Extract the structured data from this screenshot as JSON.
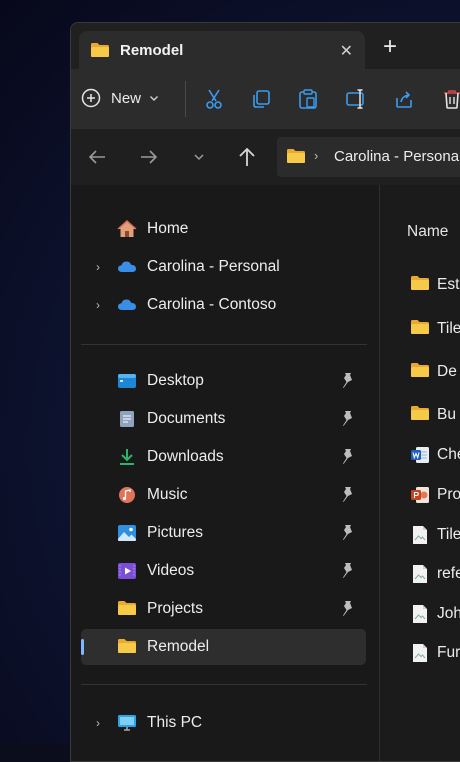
{
  "tab": {
    "title": "Remodel",
    "close_glyph": "✕",
    "new_tab_glyph": "+"
  },
  "toolbar": {
    "new_label": "New",
    "buttons": [
      "cut-icon",
      "copy-icon",
      "paste-icon",
      "rename-icon",
      "share-icon",
      "delete-icon"
    ]
  },
  "address": {
    "chevron": "›",
    "path": "Carolina - Personal"
  },
  "sidebar": {
    "items": [
      {
        "label": "Home",
        "icon": "home-icon"
      },
      {
        "label": "Carolina - Personal",
        "icon": "cloud-icon",
        "expandable": true
      },
      {
        "label": "Carolina - Contoso",
        "icon": "cloud-icon",
        "expandable": true
      },
      {
        "label": "Desktop",
        "icon": "desktop-icon",
        "pinned": true
      },
      {
        "label": "Documents",
        "icon": "documents-icon",
        "pinned": true
      },
      {
        "label": "Downloads",
        "icon": "downloads-icon",
        "pinned": true
      },
      {
        "label": "Music",
        "icon": "music-icon",
        "pinned": true
      },
      {
        "label": "Pictures",
        "icon": "pictures-icon",
        "pinned": true
      },
      {
        "label": "Videos",
        "icon": "videos-icon",
        "pinned": true
      },
      {
        "label": "Projects",
        "icon": "folder-icon",
        "pinned": true
      },
      {
        "label": "Remodel",
        "icon": "folder-icon",
        "selected": true
      },
      {
        "label": "This PC",
        "icon": "pc-icon",
        "expandable": true
      }
    ],
    "chevron_glyph": "›"
  },
  "filelist": {
    "column_name": "Name",
    "files": [
      {
        "name": "Est",
        "icon": "folder-icon"
      },
      {
        "name": "Tile",
        "icon": "folder-icon"
      },
      {
        "name": "De",
        "icon": "folder-icon"
      },
      {
        "name": "Bu",
        "icon": "folder-icon"
      },
      {
        "name": "Che",
        "icon": "word-icon"
      },
      {
        "name": "Pro",
        "icon": "powerpoint-icon"
      },
      {
        "name": "Tile",
        "icon": "image-file-icon"
      },
      {
        "name": "refe",
        "icon": "image-file-icon"
      },
      {
        "name": "Joh",
        "icon": "image-file-icon"
      },
      {
        "name": "Fur",
        "icon": "image-file-icon"
      }
    ]
  },
  "colors": {
    "folder": "#f7c948",
    "accent": "#7fb6ff",
    "cloud": "#3a8ee6"
  }
}
